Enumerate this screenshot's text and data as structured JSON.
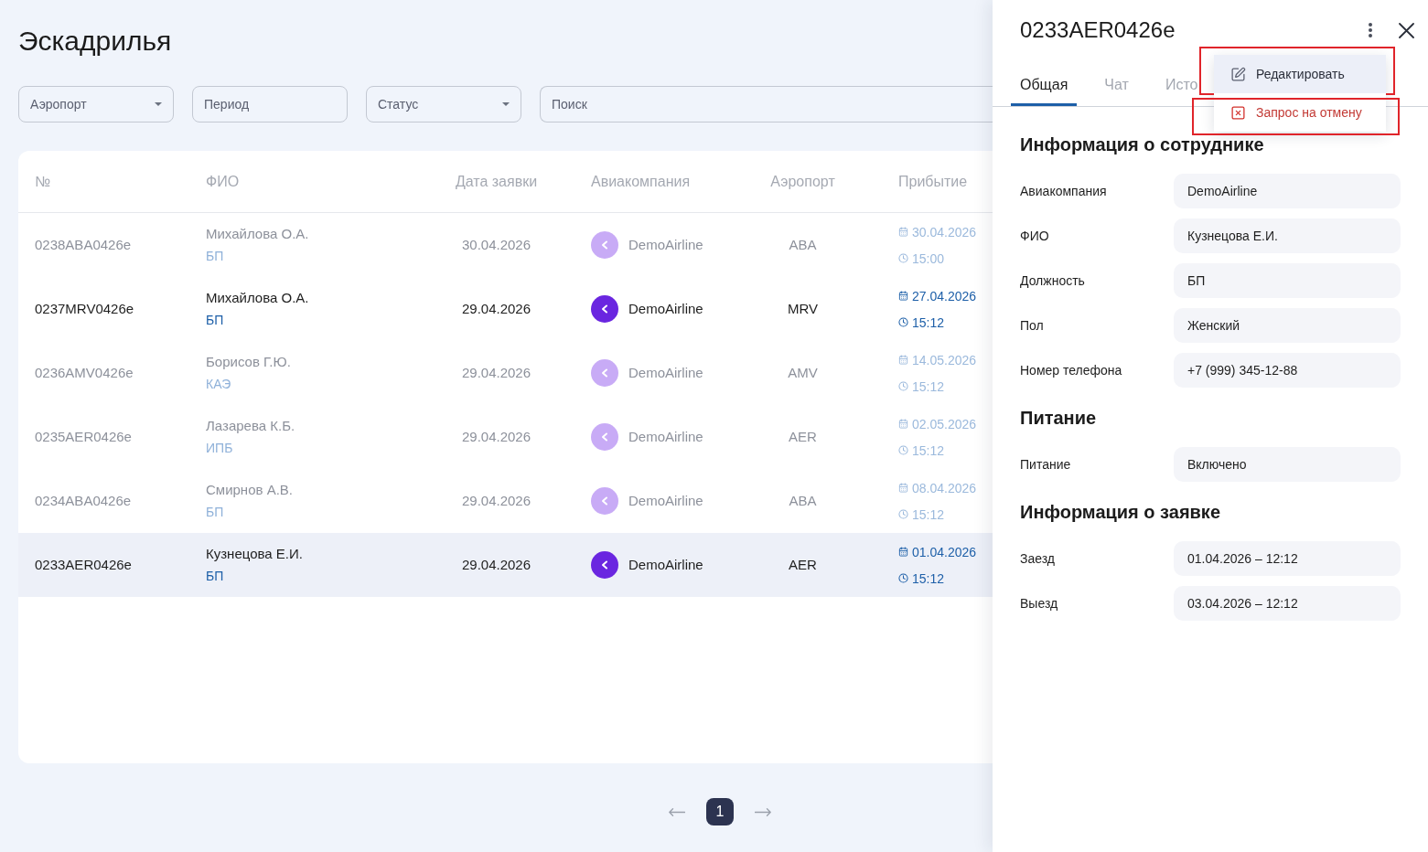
{
  "page": {
    "title": "Эскадрилья"
  },
  "filters": [
    {
      "kind": "select",
      "placeholder": "Аэропорт"
    },
    {
      "kind": "text",
      "placeholder": "Период"
    },
    {
      "kind": "select",
      "placeholder": "Статус"
    },
    {
      "kind": "search",
      "placeholder": "Поиск"
    }
  ],
  "table": {
    "columns": [
      "№",
      "ФИО",
      "Дата заявки",
      "Авиакомпания",
      "Аэропорт",
      "Прибытие"
    ],
    "rows": [
      {
        "number": "0238ABA0426e",
        "name": "Михайлова О.А.",
        "position": "БП",
        "request_date": "30.04.2026",
        "airline": "DemoAirline",
        "airport": "ABA",
        "arrival_date": "30.04.2026",
        "arrival_time": "15:00",
        "dimmed": true,
        "selected": false
      },
      {
        "number": "0237MRV0426e",
        "name": "Михайлова О.А.",
        "position": "БП",
        "request_date": "29.04.2026",
        "airline": "DemoAirline",
        "airport": "MRV",
        "arrival_date": "27.04.2026",
        "arrival_time": "15:12",
        "dimmed": false,
        "selected": false
      },
      {
        "number": "0236AMV0426e",
        "name": "Борисов Г.Ю.",
        "position": "КАЭ",
        "request_date": "29.04.2026",
        "airline": "DemoAirline",
        "airport": "AMV",
        "arrival_date": "14.05.2026",
        "arrival_time": "15:12",
        "dimmed": true,
        "selected": false
      },
      {
        "number": "0235AER0426e",
        "name": "Лазарева К.Б.",
        "position": "ИПБ",
        "request_date": "29.04.2026",
        "airline": "DemoAirline",
        "airport": "AER",
        "arrival_date": "02.05.2026",
        "arrival_time": "15:12",
        "dimmed": true,
        "selected": false
      },
      {
        "number": "0234ABA0426e",
        "name": "Смирнов А.В.",
        "position": "БП",
        "request_date": "29.04.2026",
        "airline": "DemoAirline",
        "airport": "ABA",
        "arrival_date": "08.04.2026",
        "arrival_time": "15:12",
        "dimmed": true,
        "selected": false
      },
      {
        "number": "0233AER0426e",
        "name": "Кузнецова Е.И.",
        "position": "БП",
        "request_date": "29.04.2026",
        "airline": "DemoAirline",
        "airport": "AER",
        "arrival_date": "01.04.2026",
        "arrival_time": "15:12",
        "dimmed": false,
        "selected": true
      }
    ]
  },
  "pagination": {
    "pages": [
      {
        "label": "1",
        "selected": true
      }
    ]
  },
  "drawer": {
    "title": "0233AER0426e",
    "tabs": [
      {
        "label": "Общая",
        "selected": true
      },
      {
        "label": "Чат",
        "selected": false
      },
      {
        "label": "Исто",
        "selected": false
      }
    ],
    "menu": [
      {
        "kind": "edit",
        "label": "Редактировать",
        "hovered": true,
        "highlighted": true
      },
      {
        "kind": "cancel",
        "label": "Запрос на отмену",
        "hovered": false,
        "highlighted": true
      }
    ],
    "sections": [
      {
        "title": "Информация о сотруднике",
        "fields": [
          {
            "label": "Авиакомпания",
            "value": "DemoAirline"
          },
          {
            "label": "ФИО",
            "value": "Кузнецова Е.И."
          },
          {
            "label": "Должность",
            "value": "БП"
          },
          {
            "label": "Пол",
            "value": "Женский"
          },
          {
            "label": "Номер телефона",
            "value": "+7 (999) 345-12-88"
          }
        ]
      },
      {
        "title": "Питание",
        "fields": [
          {
            "label": "Питание",
            "value": "Включено"
          }
        ]
      },
      {
        "title": "Информация о заявке",
        "fields": [
          {
            "label": "Заезд",
            "value": "01.04.2026 – 12:12"
          },
          {
            "label": "Выезд",
            "value": "03.04.2026 – 12:12"
          }
        ]
      }
    ]
  }
}
